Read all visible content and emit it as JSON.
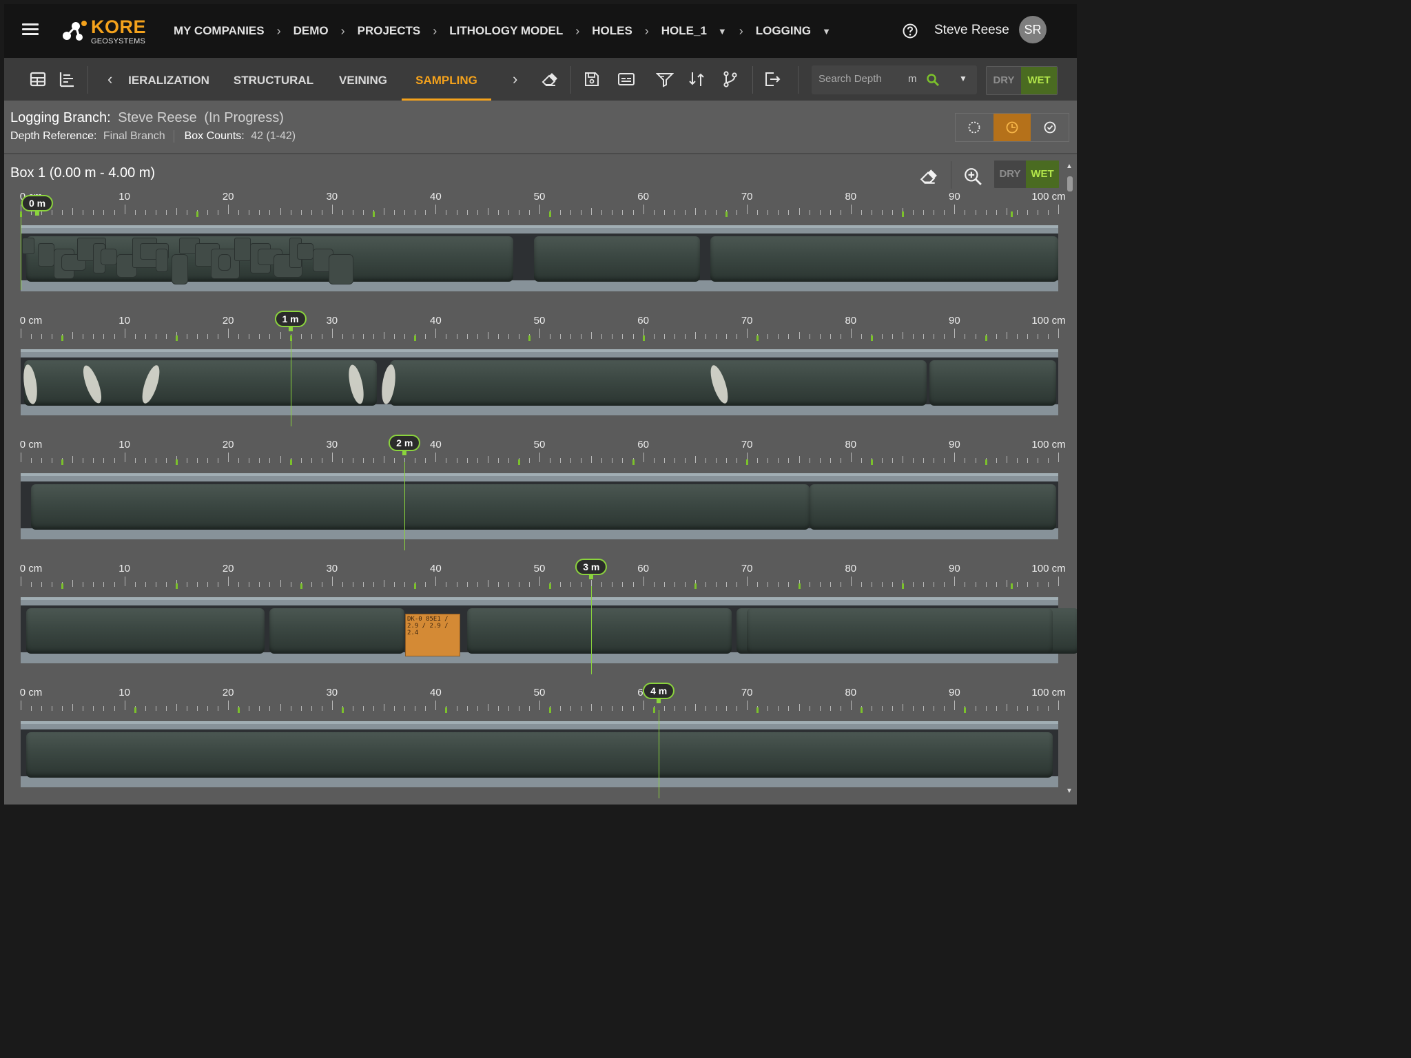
{
  "app": {
    "brand": "KORE",
    "brand_sub": "GEOSYSTEMS",
    "accent_color": "#f4a21c",
    "wet_color": "#4a6b21"
  },
  "breadcrumb": [
    {
      "label": "MY COMPANIES",
      "dropdown": false
    },
    {
      "label": "DEMO",
      "dropdown": false
    },
    {
      "label": "PROJECTS",
      "dropdown": false
    },
    {
      "label": "LITHOLOGY MODEL",
      "dropdown": false
    },
    {
      "label": "HOLES",
      "dropdown": false
    },
    {
      "label": "HOLE_1",
      "dropdown": true
    },
    {
      "label": "LOGGING",
      "dropdown": true
    }
  ],
  "user": {
    "name": "Steve Reese",
    "initials": "SR"
  },
  "toolbar": {
    "tabs": [
      {
        "label": "IERALIZATION",
        "active": false
      },
      {
        "label": "STRUCTURAL",
        "active": false
      },
      {
        "label": "VEINING",
        "active": false
      },
      {
        "label": "SAMPLING",
        "active": true
      }
    ],
    "search": {
      "placeholder": "Search Depth",
      "unit": "m"
    },
    "dry_label": "DRY",
    "wet_label": "WET",
    "wet_selected": true
  },
  "info": {
    "branch_label": "Logging Branch:",
    "branch_value": "Steve Reese",
    "branch_status": "(In Progress)",
    "depth_ref_label": "Depth Reference:",
    "depth_ref_value": "Final Branch",
    "box_counts_label": "Box Counts:",
    "box_counts_value": "42 (1-42)"
  },
  "box": {
    "title": "Box 1 (0.00 m - 4.00 m)",
    "dry_label": "DRY",
    "wet_label": "WET",
    "ruler_labels": [
      "0 cm",
      "10",
      "20",
      "30",
      "40",
      "50",
      "60",
      "70",
      "80",
      "90",
      "100 cm"
    ],
    "rows": [
      {
        "marker_label": "0 m",
        "marker_cm": 0
      },
      {
        "marker_label": "1 m",
        "marker_cm": 26
      },
      {
        "marker_label": "2 m",
        "marker_cm": 37
      },
      {
        "marker_label": "3 m",
        "marker_cm": 55
      },
      {
        "marker_label": "4 m",
        "marker_cm": 61.5
      }
    ],
    "sample_tag_text": "DK-0 85E1 / 2.9 / 2.9 / 2.4"
  }
}
